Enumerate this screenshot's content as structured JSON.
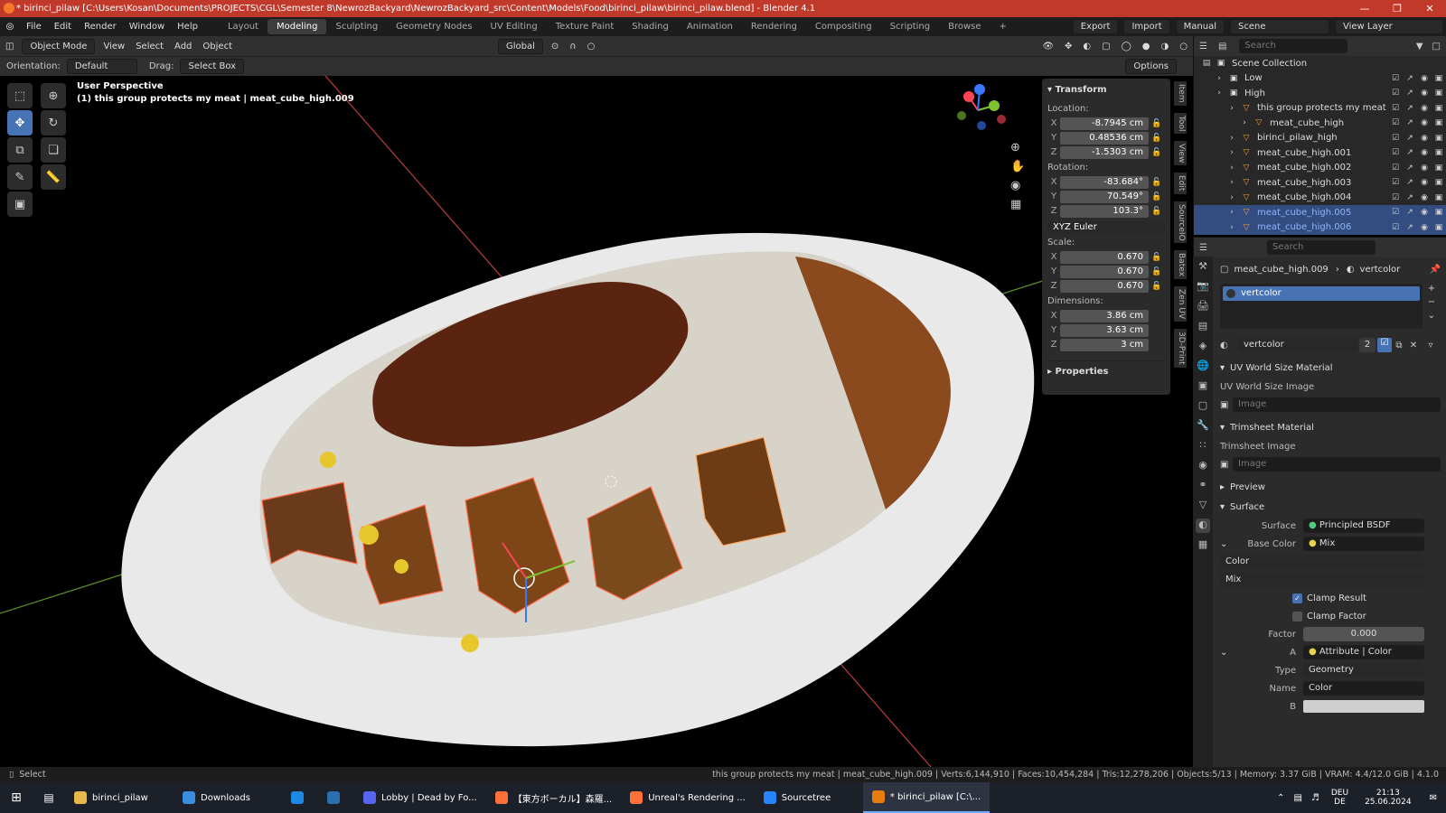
{
  "window": {
    "title": "* birinci_pilaw [C:\\Users\\Kosan\\Documents\\PROJECTS\\CGL\\Semester 8\\NewrozBackyard\\NewrozBackyard_src\\Content\\Models\\Food\\birinci_pilaw\\birinci_pilaw.blend] - Blender 4.1"
  },
  "menu": {
    "items": [
      "File",
      "Edit",
      "Render",
      "Window",
      "Help"
    ],
    "workspaces": [
      "Layout",
      "Modeling",
      "Sculpting",
      "Geometry Nodes",
      "UV Editing",
      "Texture Paint",
      "Shading",
      "Animation",
      "Rendering",
      "Compositing",
      "Scripting",
      "Browse"
    ],
    "active_workspace": "Modeling",
    "export": "Export",
    "import": "Import",
    "manual": "Manual",
    "scene": "Scene",
    "view_layer": "View Layer"
  },
  "header": {
    "mode": "Object Mode",
    "view": "View",
    "select": "Select",
    "add": "Add",
    "object": "Object",
    "transform_orientation": "Global",
    "orientation_label": "Orientation:",
    "orientation_value": "Default",
    "drag_label": "Drag:",
    "drag_value": "Select Box",
    "options": "Options"
  },
  "viewport": {
    "perspective": "User Perspective",
    "active_info": "(1) this group protects my meat | meat_cube_high.009"
  },
  "npanel": {
    "transform_title": "Transform",
    "location_label": "Location:",
    "location": [
      {
        "axis": "X",
        "value": "-8.7945 cm"
      },
      {
        "axis": "Y",
        "value": "0.48536 cm"
      },
      {
        "axis": "Z",
        "value": "-1.5303 cm"
      }
    ],
    "rotation_label": "Rotation:",
    "rotation": [
      {
        "axis": "X",
        "value": "-83.684°"
      },
      {
        "axis": "Y",
        "value": "70.549°"
      },
      {
        "axis": "Z",
        "value": "103.3°"
      }
    ],
    "rotation_mode": "XYZ Euler",
    "scale_label": "Scale:",
    "scale": [
      {
        "axis": "X",
        "value": "0.670"
      },
      {
        "axis": "Y",
        "value": "0.670"
      },
      {
        "axis": "Z",
        "value": "0.670"
      }
    ],
    "dimensions_label": "Dimensions:",
    "dimensions": [
      {
        "axis": "X",
        "value": "3.86 cm"
      },
      {
        "axis": "Y",
        "value": "3.63 cm"
      },
      {
        "axis": "Z",
        "value": "3 cm"
      }
    ],
    "properties_title": "Properties",
    "side_tabs": [
      "Item",
      "Tool",
      "View",
      "Edit",
      "SourceIO",
      "Batex",
      "Zen UV",
      "3D-Print"
    ]
  },
  "outliner": {
    "search_placeholder": "Search",
    "rows": [
      {
        "name": "Scene Collection",
        "indent": 0,
        "selected": false
      },
      {
        "name": "Low",
        "indent": 1,
        "selected": false
      },
      {
        "name": "High",
        "indent": 1,
        "selected": false
      },
      {
        "name": "this group protects my meat",
        "indent": 2,
        "selected": false
      },
      {
        "name": "meat_cube_high",
        "indent": 3,
        "selected": false
      },
      {
        "name": "birinci_pilaw_high",
        "indent": 2,
        "selected": false
      },
      {
        "name": "meat_cube_high.001",
        "indent": 2,
        "selected": false
      },
      {
        "name": "meat_cube_high.002",
        "indent": 2,
        "selected": false
      },
      {
        "name": "meat_cube_high.003",
        "indent": 2,
        "selected": false
      },
      {
        "name": "meat_cube_high.004",
        "indent": 2,
        "selected": false
      },
      {
        "name": "meat_cube_high.005",
        "indent": 2,
        "selected": true
      },
      {
        "name": "meat_cube_high.006",
        "indent": 2,
        "selected": true
      }
    ]
  },
  "properties": {
    "search_placeholder": "Search",
    "breadcrumb_object": "meat_cube_high.009",
    "breadcrumb_material": "vertcolor",
    "slot_name": "vertcolor",
    "material_name": "vertcolor",
    "user_count": "2",
    "uv_world_size_material": "UV World Size Material",
    "uv_world_size_image": "UV World Size Image",
    "image_placeholder": "Image",
    "trimsheet_material": "Trimsheet Material",
    "trimsheet_image": "Trimsheet Image",
    "preview": "Preview",
    "surface_section": "Surface",
    "surface_label": "Surface",
    "surface_value": "Principled BSDF",
    "base_color_label": "Base Color",
    "base_color_value": "Mix",
    "color_dropdown": "Color",
    "mix_dropdown": "Mix",
    "clamp_result": "Clamp Result",
    "clamp_factor": "Clamp Factor",
    "factor_label": "Factor",
    "factor_value": "0.000",
    "a_label": "A",
    "a_value": "Attribute | Color",
    "type_label": "Type",
    "type_value": "Geometry",
    "name_label": "Name",
    "name_value": "Color",
    "b_label": "B"
  },
  "status": {
    "left": "Select",
    "right": "this group protects my meat | meat_cube_high.009 | Verts:6,144,910 | Faces:10,454,284 | Tris:12,278,206 | Objects:5/13 | Memory: 3.37 GiB | VRAM: 4.4/12.0 GiB | 4.1.0"
  },
  "taskbar": {
    "items": [
      {
        "label": "birinci_pilaw",
        "color": "#e8b84a"
      },
      {
        "label": "Downloads",
        "color": "#3b8de0"
      },
      {
        "label": "",
        "color": "#1e88e5"
      },
      {
        "label": "",
        "color": "#2a6fb0"
      },
      {
        "label": "Lobby | Dead by Fo...",
        "color": "#5865f2"
      },
      {
        "label": "【東方ボーカル】森羅...",
        "color": "#ff7139"
      },
      {
        "label": "Unreal's Rendering ...",
        "color": "#ff7139"
      },
      {
        "label": "Sourcetree",
        "color": "#2684ff"
      },
      {
        "label": "* birinci_pilaw [C:\\...",
        "color": "#e87d0d"
      }
    ],
    "lang": "DEU",
    "lang2": "DE",
    "time": "21:13",
    "date": "25.06.2024"
  }
}
